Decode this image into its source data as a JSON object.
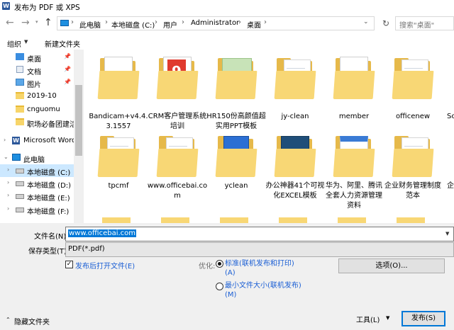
{
  "window": {
    "title": "发布为 PDF 或 XPS",
    "app_icon": "W"
  },
  "nav": {
    "breadcrumb": [
      "此电脑",
      "本地磁盘 (C:)",
      "用户",
      "Administrator",
      "桌面"
    ],
    "search_placeholder": "搜索\"桌面\"",
    "back_glyph": "←",
    "forward_glyph": "→",
    "up_glyph": "↑",
    "refresh_glyph": "↻"
  },
  "toolbar": {
    "organize": "组织",
    "new_folder": "新建文件夹"
  },
  "sidebar": {
    "items": [
      {
        "label": "桌面",
        "icon": "desktop-icon",
        "pinned": true
      },
      {
        "label": "文档",
        "icon": "document-icon",
        "pinned": true
      },
      {
        "label": "图片",
        "icon": "picture-icon",
        "pinned": true
      },
      {
        "label": "2019-10",
        "icon": "folder-icon"
      },
      {
        "label": "cnguomu",
        "icon": "folder-icon"
      },
      {
        "label": "职场必备团建活",
        "icon": "folder-icon"
      },
      {
        "label": "Microsoft Word",
        "icon": "word-icon"
      },
      {
        "label": "此电脑",
        "icon": "computer-icon"
      },
      {
        "label": "本地磁盘 (C:)",
        "icon": "drive-icon",
        "selected": true
      },
      {
        "label": "本地磁盘 (D:)",
        "icon": "drive-icon"
      },
      {
        "label": "本地磁盘 (E:)",
        "icon": "drive-icon"
      },
      {
        "label": "本地磁盘 (F:)",
        "icon": "drive-icon"
      }
    ]
  },
  "files": [
    {
      "name": "Bandicam+v4.4.3.1557"
    },
    {
      "name": "CRM客户管理系统培训"
    },
    {
      "name": "HR150份高颜值超实用PPT模板"
    },
    {
      "name": "jy-clean"
    },
    {
      "name": "member"
    },
    {
      "name": "officenew"
    },
    {
      "name": "Sc"
    },
    {
      "name": "tpcmf"
    },
    {
      "name": "www.officebai.com"
    },
    {
      "name": "yclean"
    },
    {
      "name": "办公神器41个可视化EXCEL模板"
    },
    {
      "name": "华为、阿里、腾讯全套人力资源管理资料"
    },
    {
      "name": "企业财务管理制度范本"
    },
    {
      "name": "企"
    }
  ],
  "form": {
    "filename_label": "文件名(N):",
    "filename_value": "www.officebai.com",
    "filetype_label": "保存类型(T):",
    "filetype_value": "PDF(*.pdf)",
    "open_after_label": "发布后打开文件(E)",
    "open_after_checked": true,
    "optimize_label": "优化:",
    "opt_standard": "标准(联机发布和打印)\n(A)",
    "opt_minimum": "最小文件大小(联机发布)\n(M)",
    "options_button": "选项(O)..."
  },
  "footer": {
    "hide_folders": "隐藏文件夹",
    "tools": "工具(L)",
    "publish": "发布(S)"
  }
}
